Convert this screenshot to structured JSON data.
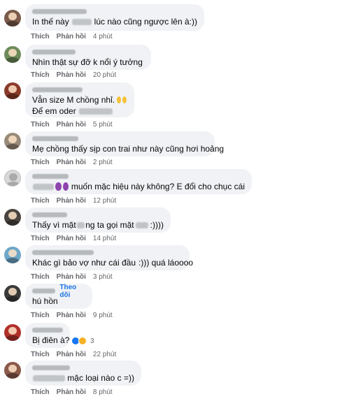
{
  "actions": {
    "like": "Thích",
    "reply": "Phản hồi"
  },
  "comments": [
    {
      "text_before": "In thế này",
      "text_after": "lúc nào cũng ngược lên à:))",
      "time": "4 phút",
      "avatar_color": "#7a5a4a"
    },
    {
      "text_before": "Nhìn thật sự đỡ k nổi ý tưởng",
      "text_after": "",
      "time": "20 phút",
      "avatar_color": "#6d8a5a"
    },
    {
      "line1": "Vẫn size M chồng nhỉ.",
      "line2_before": "Để em oder",
      "time": "5 phút",
      "avatar_color": "#8a3a2a"
    },
    {
      "text_before": "Mẹ chồng thấy sịp con trai như này cũng hơi hoảng",
      "text_after": "",
      "time": "2 phút",
      "avatar_color": "#9a8a7a"
    },
    {
      "text_before": "muốn mặc hiệu này không? E đổi cho chục cái",
      "text_after": "",
      "time": "12 phút",
      "avatar_color": "#d8d8d8"
    },
    {
      "text_before": "Thấy vì mặt",
      "text_mid": "ng ta gọi mặt",
      "text_after": ":))))",
      "time": "14 phút",
      "avatar_color": "#4a4440"
    },
    {
      "text_before": "Khác gì bảo vợ như cái đầu",
      "text_after": ":))) quá láoooo",
      "time": "3 phút",
      "avatar_color": "#6fa8c8"
    },
    {
      "follow": "Theo dõi",
      "text_before": "hú hồn",
      "text_after": "",
      "time": "9 phút",
      "avatar_color": "#3a3a3a"
    },
    {
      "text_before": "Bị điên à?",
      "text_after": "",
      "reaction_count": "3",
      "time": "22 phút",
      "avatar_color": "#b0302a"
    },
    {
      "text_before": "",
      "text_after": "mặc loại nào c =))",
      "time": "8 phút",
      "avatar_color": "#8a5a4a"
    }
  ]
}
